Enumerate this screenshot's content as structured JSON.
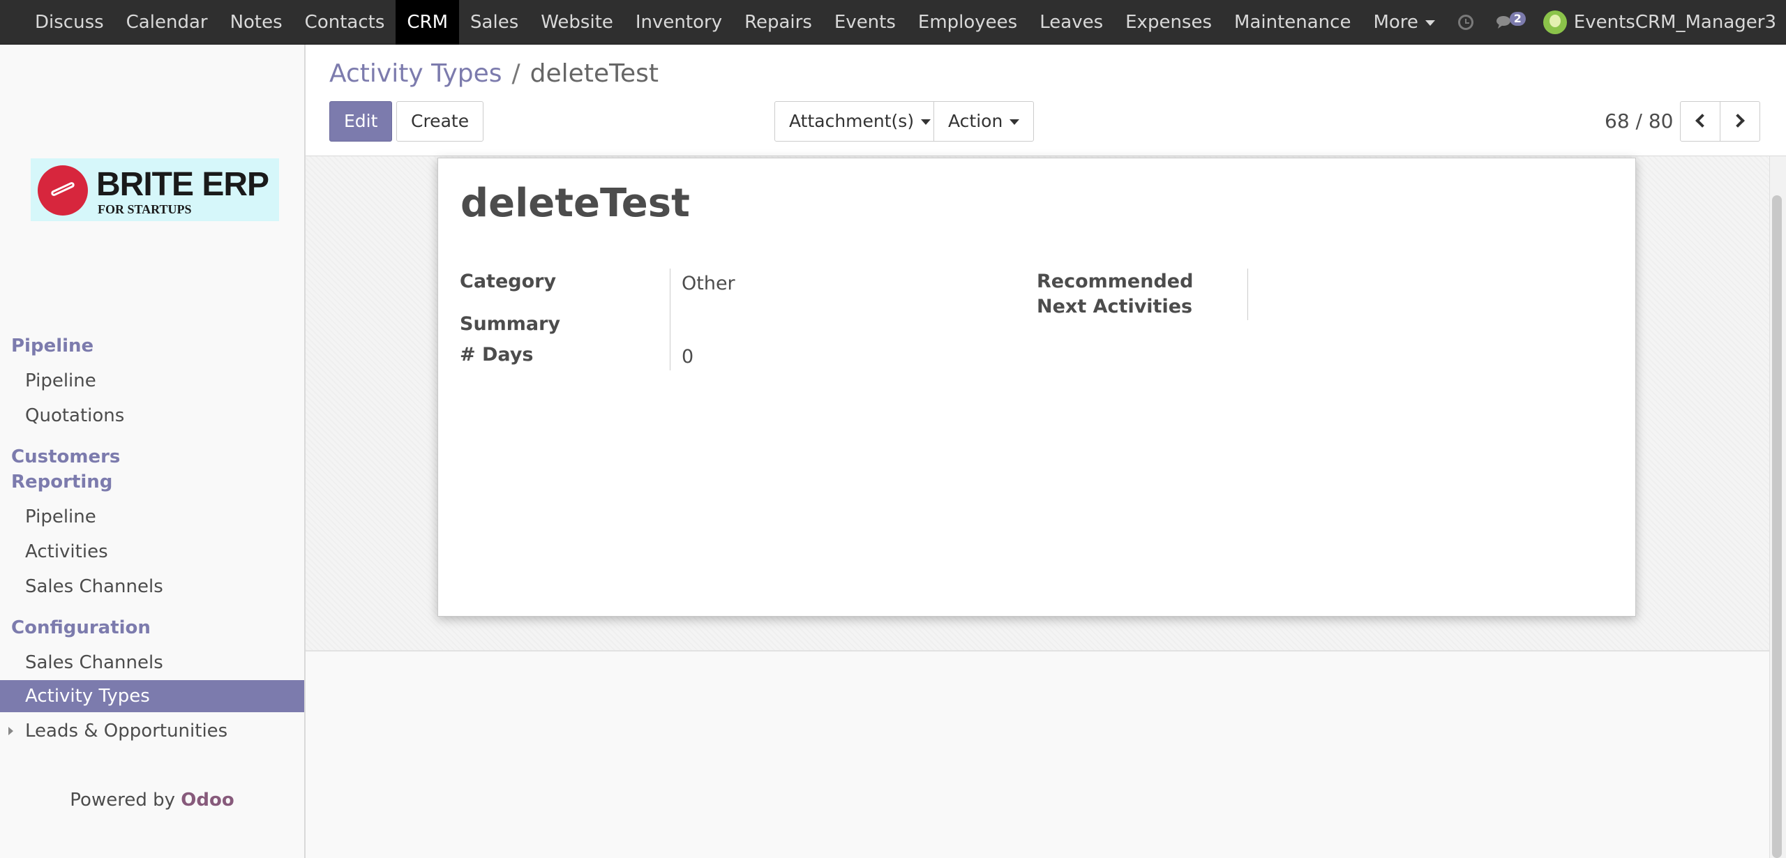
{
  "topbar": {
    "menu": [
      "Discuss",
      "Calendar",
      "Notes",
      "Contacts",
      "CRM",
      "Sales",
      "Website",
      "Inventory",
      "Repairs",
      "Events",
      "Employees",
      "Leaves",
      "Expenses",
      "Maintenance",
      "More"
    ],
    "active": "CRM",
    "chat_count": "2",
    "user": "EventsCRM_Manager3"
  },
  "logo": {
    "title": "BRITE ERP",
    "subtitle": "FOR STARTUPS"
  },
  "sidebar": {
    "sections": {
      "pipeline": "Pipeline",
      "reporting": "Customers Reporting",
      "configuration": "Configuration"
    },
    "items": {
      "pipeline": "Pipeline",
      "quotations": "Quotations",
      "report_pipeline": "Pipeline",
      "activities": "Activities",
      "report_sales_channels": "Sales Channels",
      "config_sales_channels": "Sales Channels",
      "activity_types": "Activity Types",
      "leads": "Leads & Opportunities"
    },
    "powered_by": "Powered by",
    "powered_brand": "Odoo"
  },
  "control": {
    "breadcrumb_parent": "Activity Types",
    "breadcrumb_sep": "/",
    "breadcrumb_current": "deleteTest",
    "edit_label": "Edit",
    "create_label": "Create",
    "attachments_label": "Attachment(s)",
    "action_label": "Action",
    "pager": "68 / 80"
  },
  "record": {
    "name": "deleteTest",
    "category_label": "Category",
    "category_value": "Other",
    "summary_label": "Summary",
    "summary_value": "",
    "days_label": "# Days",
    "days_value": "0",
    "next_label": "Recommended Next Activities"
  }
}
